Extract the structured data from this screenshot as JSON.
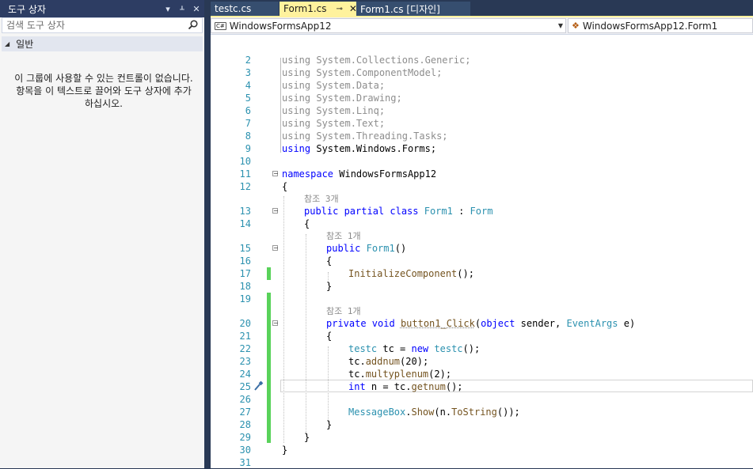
{
  "toolbox": {
    "title": "도구 상자",
    "search_placeholder": "검색 도구 상자",
    "group_label": "일반",
    "empty_message": "이 그룹에 사용할 수 있는 컨트롤이 없습니다. 항목을 이 텍스트로 끌어와 도구 상자에 추가하십시오."
  },
  "tabs": [
    {
      "label": "testc.cs"
    },
    {
      "label": "Form1.cs"
    },
    {
      "label": "Form1.cs [디자인]"
    }
  ],
  "nav": {
    "project": "WindowsFormsApp12",
    "class": "WindowsFormsApp12.Form1"
  },
  "code": {
    "ref_hints": [
      "참조 3개",
      "참조 1개",
      "참조 1개"
    ],
    "line_numbers": [
      "2",
      "3",
      "4",
      "5",
      "6",
      "7",
      "8",
      "9",
      "10",
      "11",
      "12",
      "13",
      "14",
      "15",
      "16",
      "17",
      "18",
      "19",
      "20",
      "21",
      "22",
      "23",
      "24",
      "25",
      "26",
      "27",
      "28",
      "29",
      "30",
      "31"
    ]
  },
  "icons": {
    "search": "search-icon",
    "dropdown": "chevron-down-icon",
    "pin": "pin-icon",
    "close": "close-icon",
    "quick_action": "brush-icon"
  },
  "colors": {
    "active_tab": "#fff29d",
    "keyword": "#0000ff",
    "type": "#2b91af",
    "changed_bar": "#59d25a"
  }
}
